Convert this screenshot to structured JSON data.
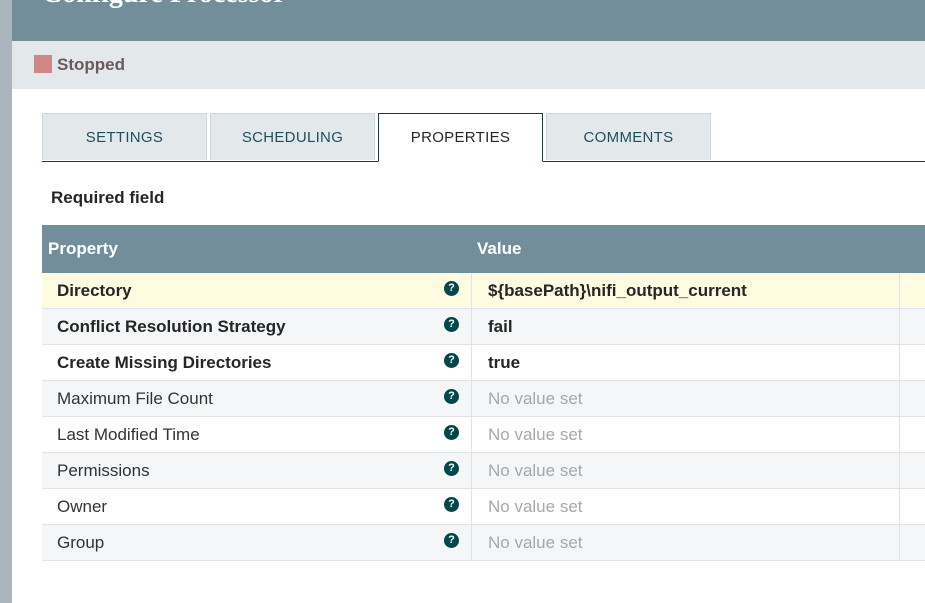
{
  "dialog": {
    "title": "Configure Processor",
    "status": {
      "label": "Stopped",
      "color": "#d18686"
    }
  },
  "tabs": [
    {
      "label": "SETTINGS",
      "active": false
    },
    {
      "label": "SCHEDULING",
      "active": false
    },
    {
      "label": "PROPERTIES",
      "active": true
    },
    {
      "label": "COMMENTS",
      "active": false
    }
  ],
  "required_field_label": "Required field",
  "table": {
    "headers": {
      "property": "Property",
      "value": "Value"
    },
    "rows": [
      {
        "property": "Directory",
        "value": "${basePath}\\nifi_output_current",
        "required": true,
        "value_set": true,
        "selected": true
      },
      {
        "property": "Conflict Resolution Strategy",
        "value": "fail",
        "required": true,
        "value_set": true
      },
      {
        "property": "Create Missing Directories",
        "value": "true",
        "required": true,
        "value_set": true
      },
      {
        "property": "Maximum File Count",
        "value": "No value set",
        "required": false,
        "value_set": false
      },
      {
        "property": "Last Modified Time",
        "value": "No value set",
        "required": false,
        "value_set": false
      },
      {
        "property": "Permissions",
        "value": "No value set",
        "required": false,
        "value_set": false
      },
      {
        "property": "Owner",
        "value": "No value set",
        "required": false,
        "value_set": false
      },
      {
        "property": "Group",
        "value": "No value set",
        "required": false,
        "value_set": false
      }
    ],
    "help_icon": "question-circle-icon"
  }
}
